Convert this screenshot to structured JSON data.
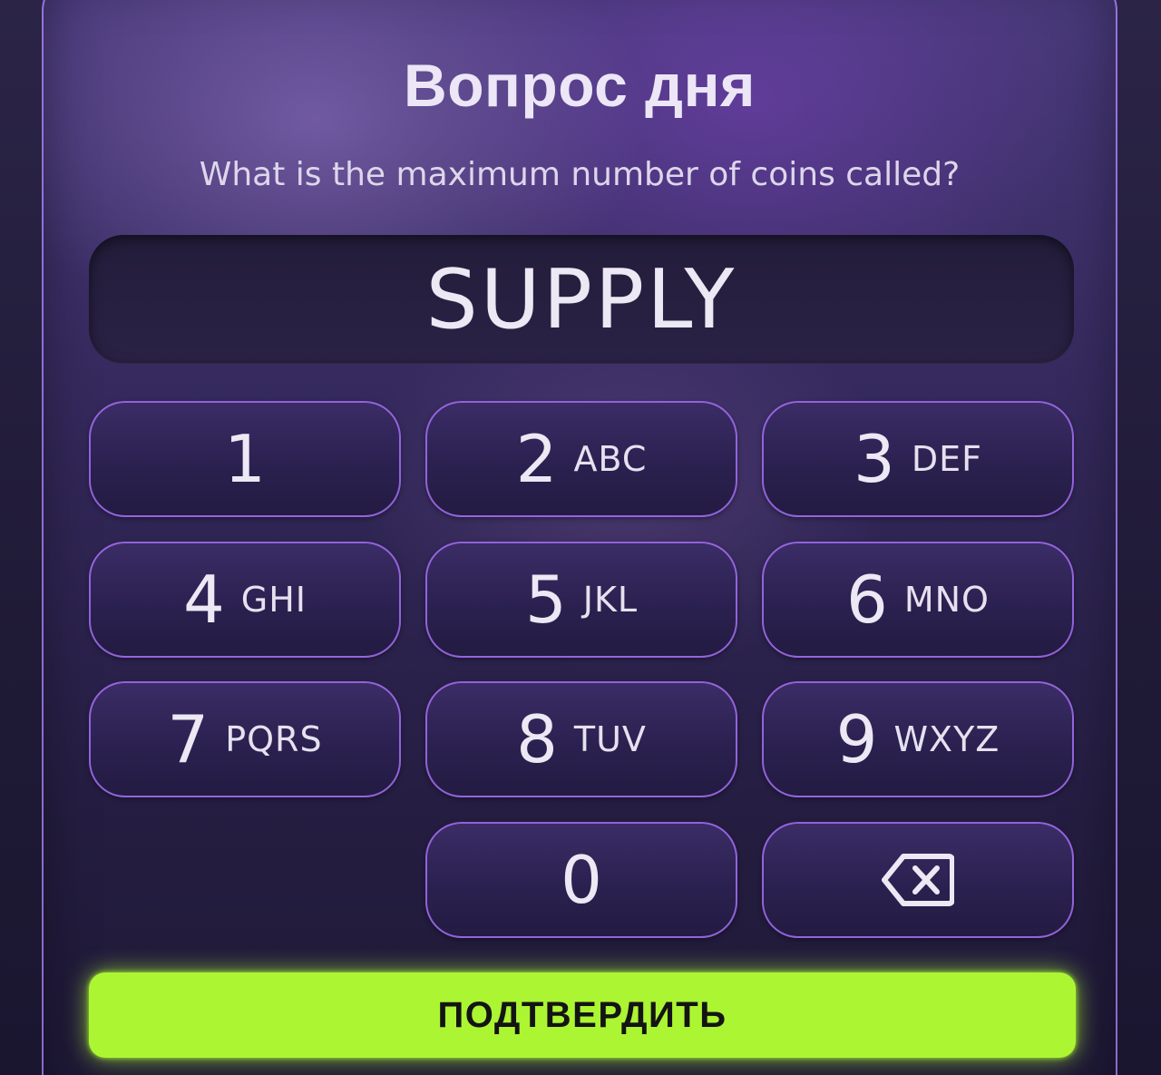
{
  "dialog": {
    "title": "Вопрос дня",
    "question": "What is the maximum number of coins called?",
    "answer": "SUPPLY"
  },
  "keypad": {
    "keys": [
      {
        "number": "1",
        "letters": ""
      },
      {
        "number": "2",
        "letters": "ABC"
      },
      {
        "number": "3",
        "letters": "DEF"
      },
      {
        "number": "4",
        "letters": "GHI"
      },
      {
        "number": "5",
        "letters": "JKL"
      },
      {
        "number": "6",
        "letters": "MNO"
      },
      {
        "number": "7",
        "letters": "PQRS"
      },
      {
        "number": "8",
        "letters": "TUV"
      },
      {
        "number": "9",
        "letters": "WXYZ"
      },
      {
        "number": "0",
        "letters": ""
      }
    ],
    "backspace_icon": "backspace-icon"
  },
  "confirm": {
    "label": "ПОДТВЕРДИТЬ"
  },
  "colors": {
    "accent_green": "#acf533",
    "key_border": "#a56ef5",
    "text": "#ece8f4"
  }
}
